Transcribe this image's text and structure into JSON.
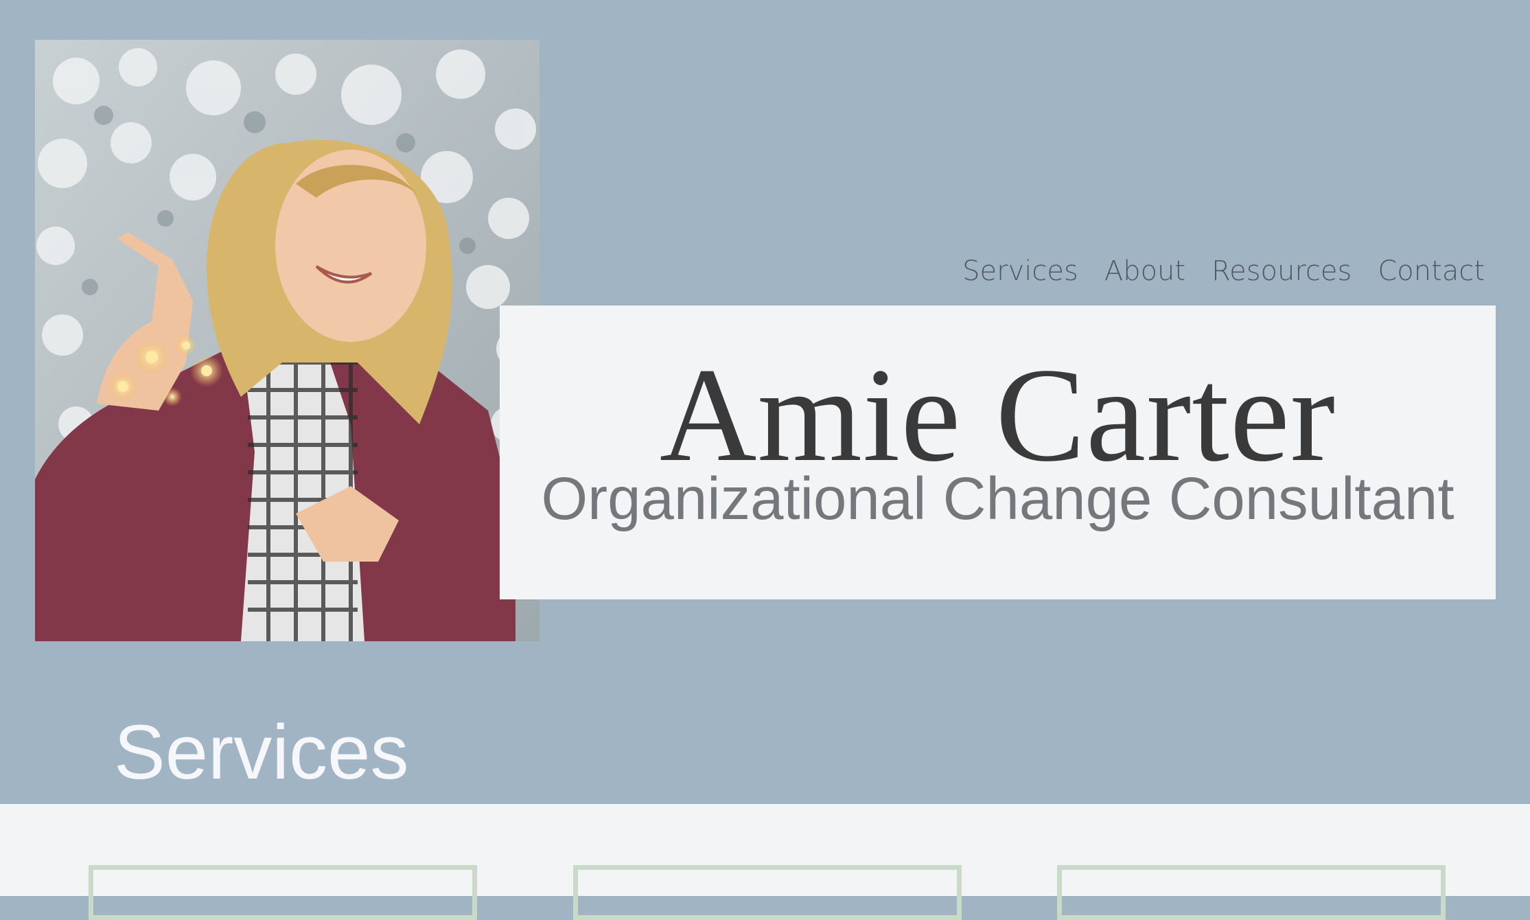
{
  "nav": {
    "items": [
      {
        "label": "Services"
      },
      {
        "label": "About"
      },
      {
        "label": "Resources"
      },
      {
        "label": "Contact"
      }
    ]
  },
  "hero": {
    "name": "Amie Carter",
    "tagline": "Organizational Change Consultant",
    "photo_alt": "Portrait photo"
  },
  "services": {
    "title": "Services",
    "cards": [
      {
        "title": ""
      },
      {
        "title": ""
      },
      {
        "title": ""
      }
    ]
  },
  "colors": {
    "hero_bg": "#a1b4c4",
    "card_bg": "#f3f4f6",
    "name_text": "#3a3a3a",
    "tagline_text": "#74787d",
    "card_border": "#c9dac8"
  }
}
